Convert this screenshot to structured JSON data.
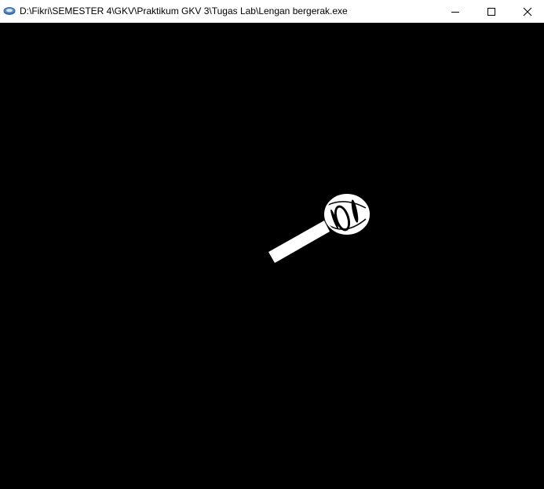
{
  "window": {
    "title": "D:\\Fikri\\SEMESTER 4\\GKV\\Praktikum GKV 3\\Tugas Lab\\Lengan bergerak.exe",
    "app_icon": "opengl-app-icon",
    "controls": {
      "minimize_icon": "minimize-icon",
      "maximize_icon": "maximize-icon",
      "close_icon": "close-icon"
    }
  },
  "scene": {
    "background_color": "#000000",
    "object_color": "#ffffff",
    "objects": [
      "upper-arm",
      "elbow-joint-wireframe-sphere"
    ]
  }
}
